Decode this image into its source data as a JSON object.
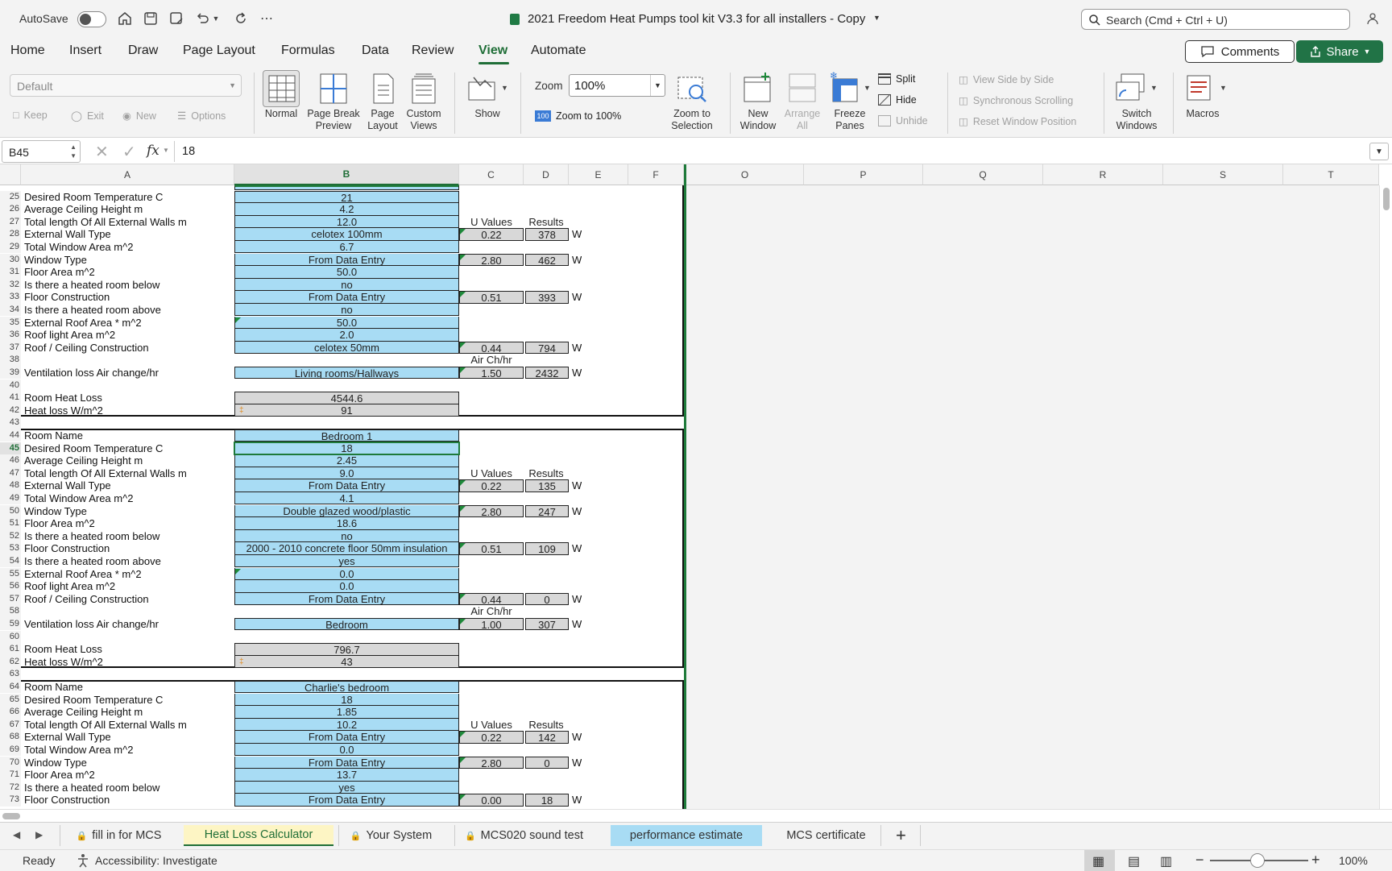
{
  "titlebar": {
    "autosave_label": "AutoSave",
    "document_title": "2021 Freedom Heat Pumps tool kit V3.3 for all installers - Copy",
    "search_placeholder": "Search (Cmd + Ctrl + U)"
  },
  "ribbon_tabs": [
    {
      "label": "Home"
    },
    {
      "label": "Insert"
    },
    {
      "label": "Draw"
    },
    {
      "label": "Page Layout"
    },
    {
      "label": "Formulas"
    },
    {
      "label": "Data"
    },
    {
      "label": "Review"
    },
    {
      "label": "View"
    },
    {
      "label": "Automate"
    }
  ],
  "active_tab": "View",
  "comments_label": "Comments",
  "share_label": "Share",
  "ribbon": {
    "sheet_view_value": "Default",
    "keep_label": "Keep",
    "exit_label": "Exit",
    "new_label": "New",
    "options_label": "Options",
    "normal_label": "Normal",
    "page_break_label_1": "Page Break",
    "page_break_label_2": "Preview",
    "page_layout_label_1": "Page",
    "page_layout_label_2": "Layout",
    "custom_views_label_1": "Custom",
    "custom_views_label_2": "Views",
    "show_label": "Show",
    "zoom_label": "Zoom",
    "zoom_value": "100%",
    "zoom100_label": "Zoom to 100%",
    "zoom_sel_label_1": "Zoom to",
    "zoom_sel_label_2": "Selection",
    "new_window_label_1": "New",
    "new_window_label_2": "Window",
    "arrange_label_1": "Arrange",
    "arrange_label_2": "All",
    "freeze_label_1": "Freeze",
    "freeze_label_2": "Panes",
    "split_label": "Split",
    "hide_label": "Hide",
    "unhide_label": "Unhide",
    "side_by_side_label": "View Side by Side",
    "sync_scroll_label": "Synchronous Scrolling",
    "reset_window_label": "Reset Window Position",
    "switch_windows_label_1": "Switch",
    "switch_windows_label_2": "Windows",
    "macros_label": "Macros"
  },
  "formula_bar": {
    "name_box": "B45",
    "fx": "fx",
    "value": "18"
  },
  "columns": [
    "A",
    "B",
    "C",
    "D",
    "E",
    "F",
    "O",
    "P",
    "Q",
    "R",
    "S",
    "T"
  ],
  "rows": [
    {
      "n": "25",
      "a": "Desired Room Temperature C",
      "b": "21",
      "bs": "blue"
    },
    {
      "n": "26",
      "a": "Average Ceiling Height m",
      "b": "4.2",
      "bs": "blue"
    },
    {
      "n": "27",
      "a": "Total length Of All External Walls m",
      "b": "12.0",
      "bs": "blue",
      "c": "U Values",
      "d": "Results",
      "hdr": true
    },
    {
      "n": "28",
      "a": "External Wall Type",
      "b": "celotex 100mm",
      "bs": "blue",
      "c": "0.22",
      "d": "378",
      "e": "W",
      "num": true
    },
    {
      "n": "29",
      "a": "Total Window Area m^2",
      "b": "6.7",
      "bs": "blue"
    },
    {
      "n": "30",
      "a": "Window Type",
      "b": "From Data Entry",
      "bs": "blue",
      "c": "2.80",
      "d": "462",
      "e": "W",
      "num": true
    },
    {
      "n": "31",
      "a": "Floor Area m^2",
      "b": "50.0",
      "bs": "blue"
    },
    {
      "n": "32",
      "a": "Is there a heated room below",
      "b": "no",
      "bs": "blue"
    },
    {
      "n": "33",
      "a": "Floor Construction",
      "b": "From Data Entry",
      "bs": "blue",
      "c": "0.51",
      "d": "393",
      "e": "W",
      "num": true
    },
    {
      "n": "34",
      "a": "Is there a heated room above",
      "b": "no",
      "bs": "blue"
    },
    {
      "n": "35",
      "a": "External Roof Area * m^2",
      "b": "50.0",
      "bs": "blue"
    },
    {
      "n": "36",
      "a": "Roof light Area m^2",
      "b": "2.0",
      "bs": "blue"
    },
    {
      "n": "37",
      "a": "Roof / Ceiling Construction",
      "b": "celotex 50mm",
      "bs": "blue",
      "c": "0.44",
      "d": "794",
      "e": "W",
      "num": true
    },
    {
      "n": "38",
      "a": "",
      "c": "Air Ch/hr",
      "hdr": true
    },
    {
      "n": "39",
      "a": "Ventilation loss Air change/hr",
      "b": "Living rooms/Hallways",
      "bs": "blue",
      "c": "1.50",
      "d": "2432",
      "e": "W",
      "num": true
    },
    {
      "n": "40",
      "a": ""
    },
    {
      "n": "41",
      "a": "Room Heat Loss",
      "b": "4544.6",
      "bs": "grey"
    },
    {
      "n": "42",
      "a": "Heat loss W/m^2",
      "b": "91",
      "bs": "grey"
    },
    {
      "n": "43",
      "a": ""
    },
    {
      "n": "44",
      "a": "Room Name",
      "b": "Bedroom 1",
      "bs": "blue"
    },
    {
      "n": "45",
      "a": "Desired Room Temperature C",
      "b": "18",
      "bs": "blue"
    },
    {
      "n": "46",
      "a": "Average Ceiling Height m",
      "b": "2.45",
      "bs": "blue"
    },
    {
      "n": "47",
      "a": "Total length Of All External Walls m",
      "b": "9.0",
      "bs": "blue",
      "c": "U Values",
      "d": "Results",
      "hdr": true
    },
    {
      "n": "48",
      "a": "External Wall Type",
      "b": "From Data Entry",
      "bs": "blue",
      "c": "0.22",
      "d": "135",
      "e": "W",
      "num": true
    },
    {
      "n": "49",
      "a": "Total Window Area m^2",
      "b": "4.1",
      "bs": "blue"
    },
    {
      "n": "50",
      "a": "Window Type",
      "b": "Double glazed wood/plastic",
      "bs": "blue",
      "c": "2.80",
      "d": "247",
      "e": "W",
      "num": true
    },
    {
      "n": "51",
      "a": "Floor Area m^2",
      "b": "18.6",
      "bs": "blue"
    },
    {
      "n": "52",
      "a": "Is there a heated room below",
      "b": "no",
      "bs": "blue"
    },
    {
      "n": "53",
      "a": "Floor Construction",
      "b": "2000 - 2010 concrete floor 50mm insulation",
      "bs": "blue",
      "c": "0.51",
      "d": "109",
      "e": "W",
      "num": true
    },
    {
      "n": "54",
      "a": "Is there a heated room above",
      "b": "yes",
      "bs": "blue"
    },
    {
      "n": "55",
      "a": "External Roof Area * m^2",
      "b": "0.0",
      "bs": "blue"
    },
    {
      "n": "56",
      "a": "Roof light Area m^2",
      "b": "0.0",
      "bs": "blue"
    },
    {
      "n": "57",
      "a": "Roof / Ceiling Construction",
      "b": "From Data Entry",
      "bs": "blue",
      "c": "0.44",
      "d": "0",
      "e": "W",
      "num": true
    },
    {
      "n": "58",
      "a": "",
      "c": "Air Ch/hr",
      "hdr": true
    },
    {
      "n": "59",
      "a": "Ventilation loss Air change/hr",
      "b": "Bedroom",
      "bs": "blue",
      "c": "1.00",
      "d": "307",
      "e": "W",
      "num": true
    },
    {
      "n": "60",
      "a": ""
    },
    {
      "n": "61",
      "a": "Room Heat Loss",
      "b": "796.7",
      "bs": "grey"
    },
    {
      "n": "62",
      "a": "Heat loss W/m^2",
      "b": "43",
      "bs": "grey"
    },
    {
      "n": "63",
      "a": ""
    },
    {
      "n": "64",
      "a": "Room Name",
      "b": "Charlie's bedroom",
      "bs": "blue"
    },
    {
      "n": "65",
      "a": "Desired Room Temperature C",
      "b": "18",
      "bs": "blue"
    },
    {
      "n": "66",
      "a": "Average Ceiling Height m",
      "b": "1.85",
      "bs": "blue"
    },
    {
      "n": "67",
      "a": "Total length Of All External Walls m",
      "b": "10.2",
      "bs": "blue",
      "c": "U Values",
      "d": "Results",
      "hdr": true
    },
    {
      "n": "68",
      "a": "External Wall Type",
      "b": "From Data Entry",
      "bs": "blue",
      "c": "0.22",
      "d": "142",
      "e": "W",
      "num": true
    },
    {
      "n": "69",
      "a": "Total Window Area m^2",
      "b": "0.0",
      "bs": "blue"
    },
    {
      "n": "70",
      "a": "Window Type",
      "b": "From Data Entry",
      "bs": "blue",
      "c": "2.80",
      "d": "0",
      "e": "W",
      "num": true
    },
    {
      "n": "71",
      "a": "Floor Area m^2",
      "b": "13.7",
      "bs": "blue"
    },
    {
      "n": "72",
      "a": "Is there a heated room below",
      "b": "yes",
      "bs": "blue"
    },
    {
      "n": "73",
      "a": "Floor Construction",
      "b": "From Data Entry",
      "bs": "blue",
      "c": "0.00",
      "d": "18",
      "e": "W",
      "num": true
    }
  ],
  "sheet_tabs": [
    {
      "label": "fill in for MCS",
      "locked": true,
      "style": "normal"
    },
    {
      "label": "Heat Loss Calculator",
      "locked": false,
      "style": "active"
    },
    {
      "label": "Your System",
      "locked": true,
      "style": "normal"
    },
    {
      "label": "MCS020 sound test",
      "locked": true,
      "style": "normal"
    },
    {
      "label": "performance estimate",
      "locked": false,
      "style": "blue"
    },
    {
      "label": "MCS certificate",
      "locked": false,
      "style": "normal"
    }
  ],
  "status": {
    "ready": "Ready",
    "accessibility": "Accessibility: Investigate",
    "zoom": "100%"
  },
  "colors": {
    "accent": "#1f6e37",
    "input_cell": "#a8dcf4",
    "calc_cell": "#d8d8d8",
    "share_button": "#217346"
  }
}
